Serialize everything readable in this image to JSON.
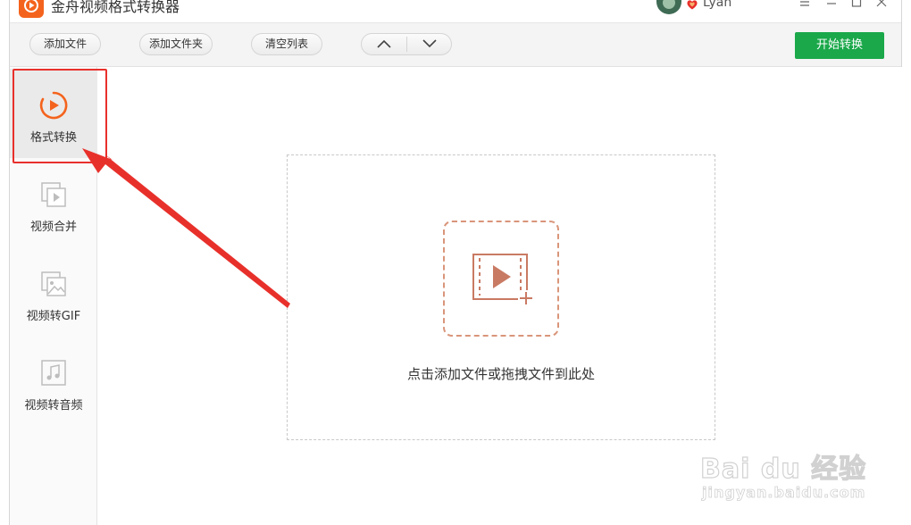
{
  "app": {
    "title": "金舟视频格式转换器",
    "user_name": "Lyan",
    "accent_color": "#f4631d",
    "primary_button_color": "#1aa84a"
  },
  "toolbar": {
    "add_file": "添加文件",
    "add_folder": "添加文件夹",
    "clear_list": "清空列表",
    "move_up_icon": "chevron-up-icon",
    "move_down_icon": "chevron-down-icon",
    "start_convert": "开始转换"
  },
  "sidebar": {
    "items": [
      {
        "label": "格式转换",
        "icon": "play-circle-icon",
        "active": true
      },
      {
        "label": "视频合并",
        "icon": "video-merge-icon",
        "active": false
      },
      {
        "label": "视频转GIF",
        "icon": "image-icon",
        "active": false
      },
      {
        "label": "视频转音频",
        "icon": "music-note-icon",
        "active": false
      }
    ]
  },
  "dropzone": {
    "hint": "点击添加文件或拖拽文件到此处",
    "icon": "add-video-icon"
  },
  "watermark": {
    "main": "Bai du 经验",
    "sub": "jingyan.baidu.com"
  },
  "annotation": {
    "color": "#e8302b"
  }
}
